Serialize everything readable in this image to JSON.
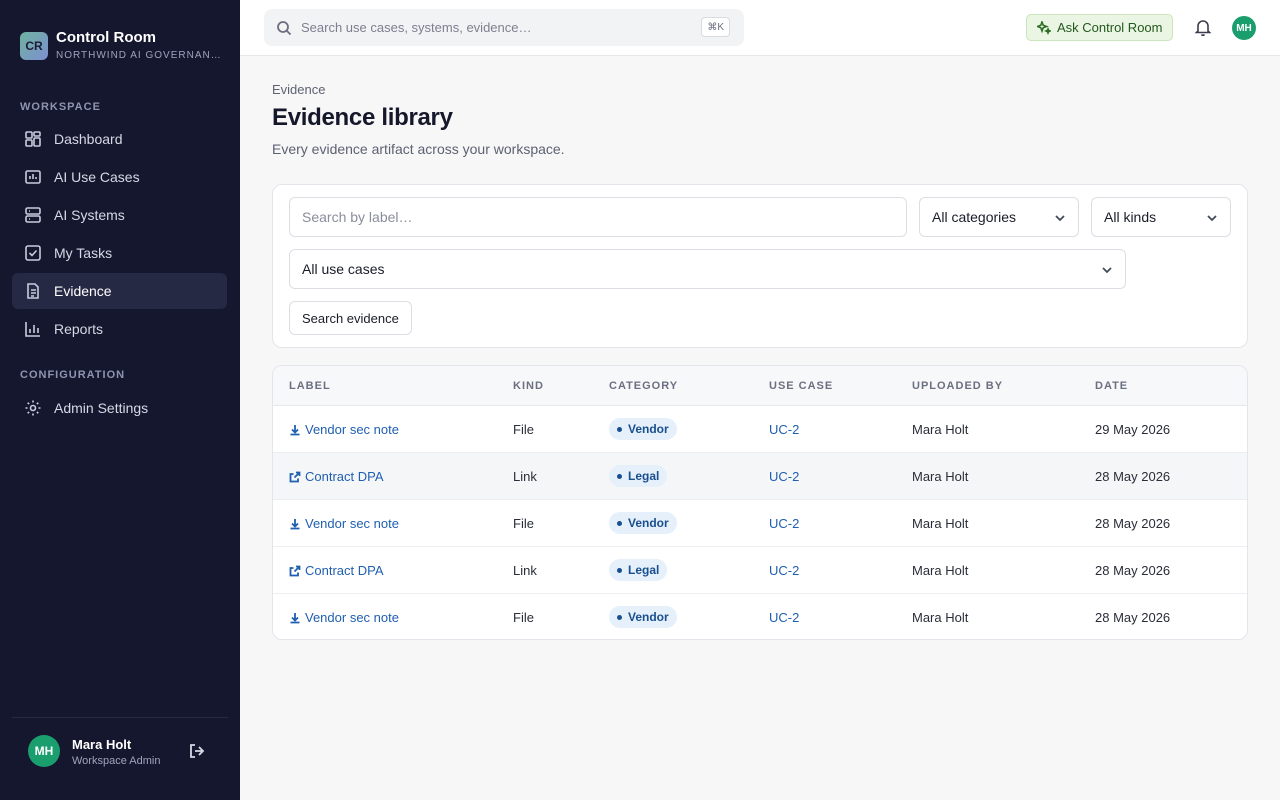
{
  "brand": {
    "logo": "CR",
    "title": "Control Room",
    "subtitle": "NORTHWIND AI GOVERNANCE"
  },
  "sidebar": {
    "workspace_label": "WORKSPACE",
    "config_label": "CONFIGURATION",
    "items": [
      {
        "label": "Dashboard",
        "icon": "dashboard-icon"
      },
      {
        "label": "AI Use Cases",
        "icon": "briefcase-icon"
      },
      {
        "label": "AI Systems",
        "icon": "server-icon"
      },
      {
        "label": "My Tasks",
        "icon": "checkbox-icon"
      },
      {
        "label": "Evidence",
        "icon": "document-icon",
        "active": true
      },
      {
        "label": "Reports",
        "icon": "bar-chart-icon"
      }
    ],
    "config_items": [
      {
        "label": "Admin Settings",
        "icon": "gear-icon"
      }
    ]
  },
  "user": {
    "initials": "MH",
    "name": "Mara Holt",
    "role": "Workspace Admin"
  },
  "topbar": {
    "search_placeholder": "Search use cases, systems, evidence…",
    "shortcut": "⌘K",
    "ask_label": "Ask Control Room"
  },
  "page": {
    "breadcrumb": "Evidence",
    "title": "Evidence library",
    "subtitle": "Every evidence artifact across your workspace."
  },
  "filters": {
    "search_placeholder": "Search by label…",
    "category": "All categories",
    "kind": "All kinds",
    "use_case": "All use cases",
    "search_button": "Search evidence"
  },
  "table": {
    "headers": [
      "LABEL",
      "KIND",
      "CATEGORY",
      "USE CASE",
      "UPLOADED BY",
      "DATE"
    ],
    "rows": [
      {
        "label": "Vendor sec note",
        "kind": "File",
        "category": "Vendor",
        "use_case": "UC-2",
        "uploaded_by": "Mara Holt",
        "date": "29 May 2026",
        "icon": "download-icon"
      },
      {
        "label": "Contract DPA",
        "kind": "Link",
        "category": "Legal",
        "use_case": "UC-2",
        "uploaded_by": "Mara Holt",
        "date": "28 May 2026",
        "icon": "external-link-icon"
      },
      {
        "label": "Vendor sec note",
        "kind": "File",
        "category": "Vendor",
        "use_case": "UC-2",
        "uploaded_by": "Mara Holt",
        "date": "28 May 2026",
        "icon": "download-icon"
      },
      {
        "label": "Contract DPA",
        "kind": "Link",
        "category": "Legal",
        "use_case": "UC-2",
        "uploaded_by": "Mara Holt",
        "date": "28 May 2026",
        "icon": "external-link-icon"
      },
      {
        "label": "Vendor sec note",
        "kind": "File",
        "category": "Vendor",
        "use_case": "UC-2",
        "uploaded_by": "Mara Holt",
        "date": "28 May 2026",
        "icon": "download-icon"
      }
    ]
  },
  "colors": {
    "sidebar_bg": "#15172e",
    "accent_link": "#1f5fb0",
    "avatar": "#1a9e6e",
    "ask_bg": "#eaf5e4"
  }
}
